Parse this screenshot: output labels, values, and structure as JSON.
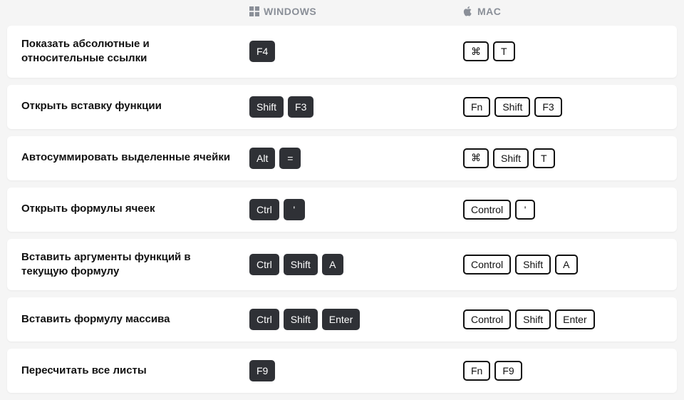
{
  "headers": {
    "windows": "WINDOWS",
    "mac": "MAC"
  },
  "rows": [
    {
      "desc": "Показать абсолютные и относительные ссылки",
      "win": [
        "F4"
      ],
      "mac": [
        "⌘",
        "T"
      ]
    },
    {
      "desc": "Открыть вставку функции",
      "win": [
        "Shift",
        "F3"
      ],
      "mac": [
        "Fn",
        "Shift",
        "F3"
      ]
    },
    {
      "desc": "Автосуммировать выделенные ячейки",
      "win": [
        "Alt",
        "="
      ],
      "mac": [
        "⌘",
        "Shift",
        "T"
      ]
    },
    {
      "desc": "Открыть формулы ячеек",
      "win": [
        "Ctrl",
        "'"
      ],
      "mac": [
        "Control",
        "'"
      ]
    },
    {
      "desc": "Вставить аргументы функций в текущую формулу",
      "win": [
        "Ctrl",
        "Shift",
        "A"
      ],
      "mac": [
        "Control",
        "Shift",
        "A"
      ]
    },
    {
      "desc": "Вставить формулу массива",
      "win": [
        "Ctrl",
        "Shift",
        "Enter"
      ],
      "mac": [
        "Control",
        "Shift",
        "Enter"
      ]
    },
    {
      "desc": "Пересчитать все листы",
      "win": [
        "F9"
      ],
      "mac": [
        "Fn",
        "F9"
      ]
    }
  ]
}
